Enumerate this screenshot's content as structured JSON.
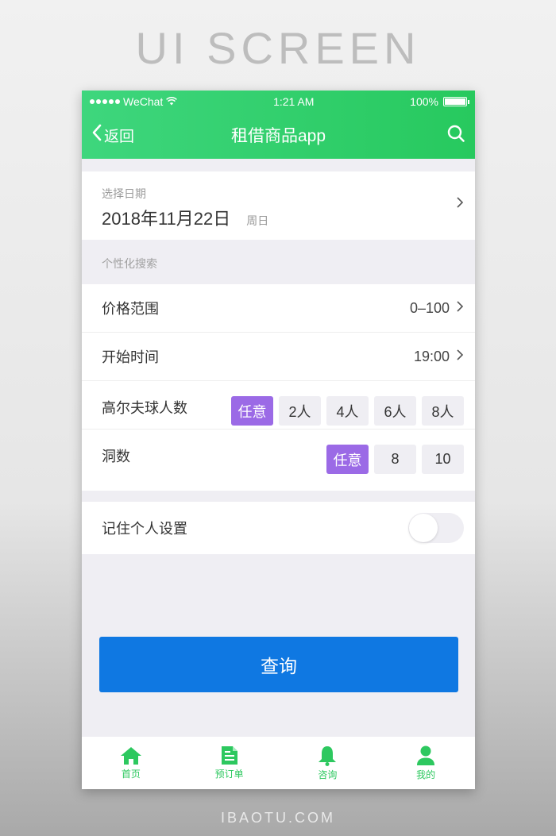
{
  "page_heading": "UI SCREEN",
  "footer_brand": "IBAOTU.COM",
  "status_bar": {
    "carrier": "WeChat",
    "time": "1:21 AM",
    "battery": "100%",
    "battery_level": 1.0
  },
  "nav": {
    "back_label": "返回",
    "title": "租借商品app",
    "back_icon": "chevron-left-icon",
    "search_icon": "search-icon"
  },
  "date_picker": {
    "label": "选择日期",
    "value": "2018年11月22日",
    "weekday": "周日"
  },
  "personalized": {
    "section_label": "个性化搜索",
    "price_range": {
      "label": "价格范围",
      "value": "0–100"
    },
    "start_time": {
      "label": "开始时间",
      "value": "19:00"
    },
    "players": {
      "label": "高尔夫球人数",
      "options": [
        "任意",
        "2人",
        "4人",
        "6人",
        "8人"
      ],
      "selected": "任意"
    },
    "holes": {
      "label": "洞数",
      "options": [
        "任意",
        "8",
        "10"
      ],
      "selected": "任意"
    }
  },
  "remember": {
    "label": "记住个人设置",
    "enabled": false
  },
  "query_button": "查询",
  "colors": {
    "header_green": "#2dc85f",
    "chip_active": "#9b6ae6",
    "primary_blue": "#0f78e2",
    "tab_green": "#2dc85f"
  },
  "tabbar": [
    {
      "label": "首页",
      "icon": "home-icon"
    },
    {
      "label": "预订单",
      "icon": "document-icon"
    },
    {
      "label": "咨询",
      "icon": "bell-icon"
    },
    {
      "label": "我的",
      "icon": "user-icon"
    }
  ]
}
